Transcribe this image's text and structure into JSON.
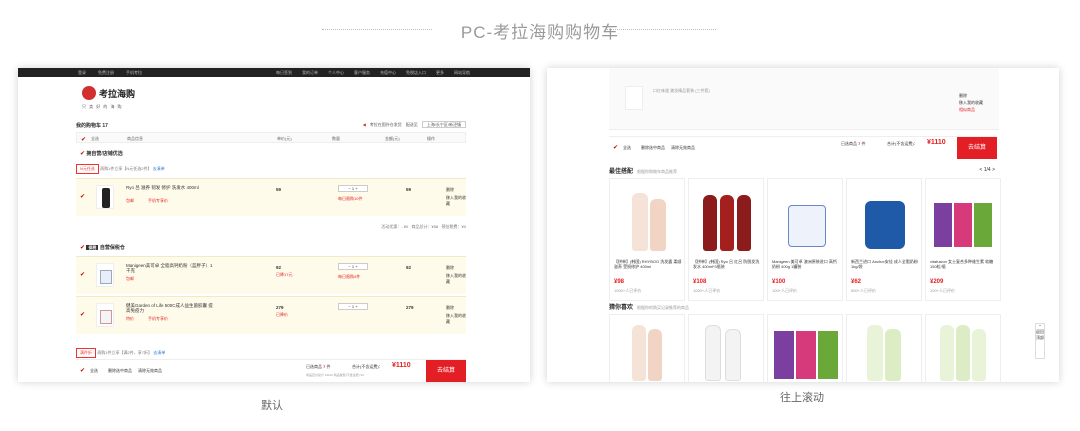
{
  "page_title": "PC-考拉海购购物车",
  "captions": {
    "left": "默认",
    "right": "往上滚动"
  },
  "topnav": {
    "left": [
      "登录",
      "免费注册",
      "手机考拉"
    ],
    "right": [
      "每日签到",
      "我的订单",
      "个人中心",
      "客户服务",
      "充值中心",
      "免税店入口",
      "更多",
      "网站导航"
    ]
  },
  "logo": {
    "name": "考拉海购",
    "slogan": "只 卖 好 的 海 购"
  },
  "cart": {
    "label": "我的购物车 17",
    "notice": "考拉在国外仓发货",
    "delivery": "配送至",
    "address": "上海/长宁区/新泾镇"
  },
  "header_cols": [
    "全选",
    "商品信息",
    "单价(元)",
    "数量",
    "金额(元)",
    "操作"
  ],
  "sections": [
    {
      "name": "拥自营/店铺优选",
      "badge": "N元任选",
      "desc": "再购1件立享【N元任选2件】",
      "link": "去凑单"
    },
    {
      "name": "自营保税仓",
      "badge": "保税"
    }
  ],
  "items": [
    {
      "name": "Ryo 吕 滋养 韧发 修护 洗发水 400ml",
      "tag": "包邮",
      "tag2": "手机专享价",
      "price": "59",
      "qty": "1",
      "amount": "59",
      "note": "每日限购10件",
      "ops": [
        "删除",
        "移入我的收藏"
      ]
    },
    {
      "name": "Manigeen美可卓 全脂高钙奶粉（蓝胖子）1千克",
      "tag": "包邮",
      "price": "92",
      "qty": "1",
      "amount": "92",
      "note": "已降17元",
      "note2": "每日限购4件",
      "ops": [
        "删除",
        "移入我的收藏"
      ]
    },
    {
      "name": "健美Garden of Life 500C成人益生菌胶囊 提高免疫力",
      "tag": "特价",
      "tag2": "手机专享价",
      "price": "279",
      "qty": "1",
      "amount": "279",
      "note": "已降价",
      "ops": [
        "删除",
        "移入我的收藏"
      ]
    }
  ],
  "summary": {
    "activity": "活动优惠：- ¥0",
    "goods": "商品总计：¥58",
    "tax": "预估税费：¥0"
  },
  "bottom_section": {
    "badge": "满件折",
    "desc": "再购1件立享【满2件，享7折】",
    "link": "去凑单"
  },
  "footer": {
    "select_all": "全选",
    "delete": "删除选中商品",
    "clear": "清除无效商品",
    "selected": "已选商品",
    "count": "7",
    "unit": "件",
    "total_label": "合计(不含运费)：",
    "total": "¥1110",
    "sub": "商品应付总计 ¥1110  商品税费(不含运费) ¥0",
    "button": "去结算"
  },
  "right": {
    "best_title": "最佳搭配",
    "best_sub": "根据你购物车商品推荐",
    "pager": "< 1/4 >",
    "guess_title": "猜你喜欢",
    "guess_sub": "根据你的购买记录推荐的商品",
    "top_item": {
      "name": "口红味道 美妆精品套装 (三件套)",
      "ops": [
        "删除",
        "移入我的收藏"
      ],
      "link": "相似商品"
    },
    "cards": [
      {
        "desc": "【拼单】(韩国) RHYBOO 洗发露 柔顺滋养 受损修护 400ml",
        "price": "¥98",
        "count": "1000+人已评价"
      },
      {
        "desc": "【拼单】(韩国) Ryo 吕 红吕 防脱发洗发水 400ml*3瓶装",
        "price": "¥108",
        "count": "1000+人已评价"
      },
      {
        "desc": "Manigeen 美可卓 澳洲原装进口 高钙奶粉 400g 1罐装",
        "price": "¥100",
        "count": "100+人已评价"
      },
      {
        "desc": "新西兰进口 Anchor安佳 成人全脂奶粉 1kg/袋",
        "price": "¥62",
        "count": "500+人已评价"
      },
      {
        "desc": "vitafusion 女士复合多种维生素 软糖 150粒/瓶",
        "price": "¥209",
        "count": "100+人已评价"
      }
    ],
    "side_tool": "返回顶部"
  },
  "colors": {
    "accent": "#e31e24",
    "highlight_row": "#fffbea"
  }
}
